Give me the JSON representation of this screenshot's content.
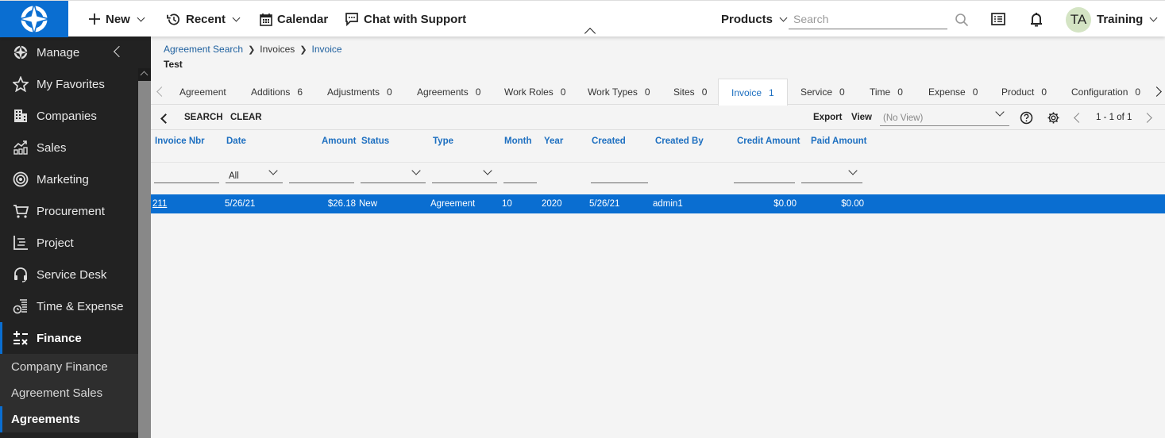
{
  "topbar": {
    "new_label": "New",
    "recent_label": "Recent",
    "calendar_label": "Calendar",
    "chat_label": "Chat with Support",
    "products_label": "Products",
    "search_placeholder": "Search",
    "avatar_initials": "TA",
    "user_label": "Training"
  },
  "sidebar": {
    "items": [
      {
        "label": "Manage",
        "icon": "compass-icon"
      },
      {
        "label": "My Favorites",
        "icon": "star-icon"
      },
      {
        "label": "Companies",
        "icon": "building-icon"
      },
      {
        "label": "Sales",
        "icon": "chart-up-icon"
      },
      {
        "label": "Marketing",
        "icon": "target-icon"
      },
      {
        "label": "Procurement",
        "icon": "cart-icon"
      },
      {
        "label": "Project",
        "icon": "project-icon"
      },
      {
        "label": "Service Desk",
        "icon": "headset-icon"
      },
      {
        "label": "Time & Expense",
        "icon": "time-expense-icon"
      },
      {
        "label": "Finance",
        "icon": "calculator-icon"
      }
    ],
    "sub_items": [
      {
        "label": "Company Finance"
      },
      {
        "label": "Agreement Sales"
      },
      {
        "label": "Agreements"
      }
    ]
  },
  "breadcrumb": {
    "items": [
      "Agreement Search",
      "Invoices",
      "Invoice"
    ]
  },
  "page_title": "Test",
  "tabs": [
    {
      "label": "Agreement",
      "count": ""
    },
    {
      "label": "Additions",
      "count": "6"
    },
    {
      "label": "Adjustments",
      "count": "0"
    },
    {
      "label": "Agreements",
      "count": "0"
    },
    {
      "label": "Work Roles",
      "count": "0"
    },
    {
      "label": "Work Types",
      "count": "0"
    },
    {
      "label": "Sites",
      "count": "0"
    },
    {
      "label": "Invoice",
      "count": "1"
    },
    {
      "label": "Service",
      "count": "0"
    },
    {
      "label": "Time",
      "count": "0"
    },
    {
      "label": "Expense",
      "count": "0"
    },
    {
      "label": "Product",
      "count": "0"
    },
    {
      "label": "Configuration",
      "count": "0"
    }
  ],
  "toolbar": {
    "search_label": "SEARCH",
    "clear_label": "CLEAR",
    "export_label": "Export",
    "view_label": "View",
    "view_value": "(No View)",
    "pager_text": "1 - 1 of 1"
  },
  "grid": {
    "columns": [
      "Invoice Nbr",
      "Date",
      "Amount",
      "Status",
      "Type",
      "Month",
      "Year",
      "Created",
      "Created By",
      "Credit Amount",
      "Paid Amount"
    ],
    "filters": {
      "date": "All"
    },
    "rows": [
      {
        "invoice_nbr": "211",
        "date": "5/26/21",
        "amount": "$26.18",
        "status": "New",
        "type": "Agreement",
        "month": "10",
        "year": "2020",
        "created": "5/26/21",
        "created_by": "admin1",
        "credit_amount": "$0.00",
        "paid_amount": "$0.00"
      }
    ]
  },
  "colors": {
    "brand": "#0a6ed1",
    "link": "#1d6fc0",
    "sidebar_bg": "#222222"
  }
}
